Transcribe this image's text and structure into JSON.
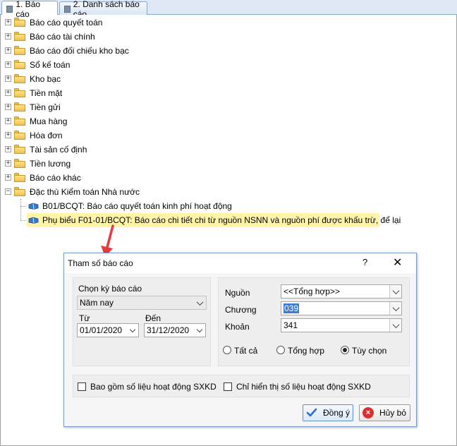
{
  "tabs": [
    {
      "label": "1. Báo cáo",
      "active": true
    },
    {
      "label": "2. Danh sách báo cáo",
      "active": false
    }
  ],
  "tree": {
    "folders": [
      {
        "label": "Báo cáo quyết toán",
        "expanded": false
      },
      {
        "label": "Báo cáo tài chính",
        "expanded": false
      },
      {
        "label": "Báo cáo đối chiếu kho bạc",
        "expanded": false
      },
      {
        "label": "Sổ kế toán",
        "expanded": false
      },
      {
        "label": "Kho bạc",
        "expanded": false
      },
      {
        "label": "Tiền mặt",
        "expanded": false
      },
      {
        "label": "Tiền gửi",
        "expanded": false
      },
      {
        "label": "Mua hàng",
        "expanded": false
      },
      {
        "label": "Hóa đơn",
        "expanded": false
      },
      {
        "label": "Tài sản cố định",
        "expanded": false
      },
      {
        "label": "Tiền lương",
        "expanded": false
      },
      {
        "label": "Báo cáo khác",
        "expanded": false
      },
      {
        "label": "Đặc thù Kiểm toán Nhà nước",
        "expanded": true
      }
    ],
    "reports": [
      {
        "label": "B01/BCQT: Báo cáo quyết toán kinh phí hoạt động",
        "selected": false
      },
      {
        "label": "Phụ biểu F01-01/BCQT: Báo cáo chi tiết chi từ nguồn NSNN và nguồn phí được khấu trừ, để lại",
        "selected": true
      }
    ]
  },
  "dialog": {
    "title": "Tham số báo cáo",
    "help": "?",
    "close": "✕",
    "period": {
      "label": "Chọn kỳ báo cáo",
      "value": "Năm nay",
      "from_label": "Từ",
      "from_value": "01/01/2020",
      "to_label": "Đến",
      "to_value": "31/12/2020"
    },
    "filters": {
      "source_label": "Nguồn",
      "source_value": "<<Tổng hợp>>",
      "chapter_label": "Chương",
      "chapter_value": "039",
      "item_label": "Khoản",
      "item_value": "341"
    },
    "radios": [
      {
        "label": "Tất cả",
        "checked": false
      },
      {
        "label": "Tổng hợp",
        "checked": false
      },
      {
        "label": "Tùy chọn",
        "checked": true
      }
    ],
    "checks": [
      {
        "label": "Bao gồm số liệu hoạt động SXKD",
        "checked": false
      },
      {
        "label": "Chỉ hiển thị số liệu hoạt động SXKD",
        "checked": false
      }
    ],
    "ok_label": "Đồng ý",
    "cancel_label": "Hủy bỏ"
  },
  "colors": {
    "highlight": "#fff4a8",
    "arrow": "#e83a3a",
    "selection": "#3b7cd1"
  }
}
